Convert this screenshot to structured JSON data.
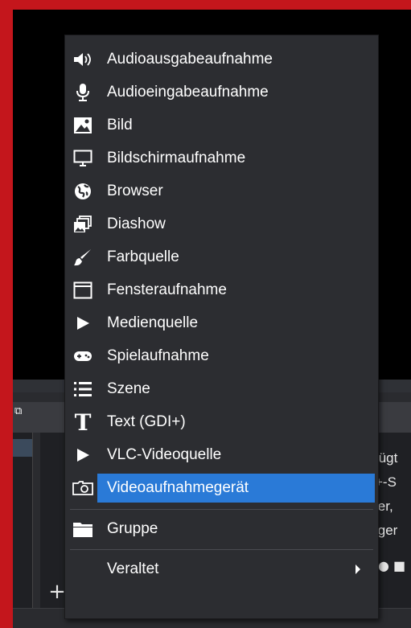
{
  "menu": {
    "items": [
      {
        "label": "Audioausgabeaufnahme",
        "icon": "speaker-icon"
      },
      {
        "label": "Audioeingabeaufnahme",
        "icon": "microphone-icon"
      },
      {
        "label": "Bild",
        "icon": "image-icon"
      },
      {
        "label": "Bildschirmaufnahme",
        "icon": "monitor-icon"
      },
      {
        "label": "Browser",
        "icon": "globe-icon"
      },
      {
        "label": "Diashow",
        "icon": "slideshow-icon"
      },
      {
        "label": "Farbquelle",
        "icon": "paintbrush-icon"
      },
      {
        "label": "Fensteraufnahme",
        "icon": "window-icon"
      },
      {
        "label": "Medienquelle",
        "icon": "play-icon"
      },
      {
        "label": "Spielaufnahme",
        "icon": "gamepad-icon"
      },
      {
        "label": "Szene",
        "icon": "list-icon"
      },
      {
        "label": "Text (GDI+)",
        "icon": "text-icon"
      },
      {
        "label": "VLC-Videoquelle",
        "icon": "play-icon"
      },
      {
        "label": "Videoaufnahmegerät",
        "icon": "camera-icon",
        "selected": true
      },
      {
        "label": "Gruppe",
        "icon": "folder-icon"
      },
      {
        "label": "Veraltet",
        "icon": "",
        "submenu": true
      }
    ],
    "highlight_color": "#2a7ad7",
    "background_color": "#2c2d31"
  },
  "background": {
    "hint_lines": [
      "fügt",
      "+-S",
      "ier, ",
      "iger"
    ],
    "add_button_label": "+",
    "frame_color": "#c4161c"
  }
}
